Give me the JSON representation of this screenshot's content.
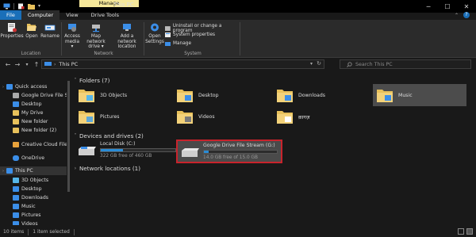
{
  "titlebar": {
    "title": "This PC",
    "context_tab": "Manage",
    "controls": [
      "─",
      "☐",
      "✕"
    ]
  },
  "tabs": [
    "File",
    "Computer",
    "View",
    "Drive Tools"
  ],
  "ribbon": {
    "location_group": {
      "label": "Location",
      "buttons": [
        "Properties",
        "Open",
        "Rename"
      ]
    },
    "network_group": {
      "label": "Network",
      "buttons": [
        "Access\nmedia ▾",
        "Map network\ndrive ▾",
        "Add a network\nlocation"
      ]
    },
    "system_group": {
      "label": "System",
      "open_settings": "Open\nSettings",
      "items": [
        "Uninstall or change a program",
        "System properties",
        "Manage"
      ]
    }
  },
  "address": {
    "path": "This PC",
    "search_placeholder": "Search This PC"
  },
  "navpane": {
    "items": [
      {
        "label": "Quick access",
        "icon": "star-icon",
        "color": "#3b8ee8",
        "expand": true
      },
      {
        "label": "Google Drive File S",
        "icon": "drive-icon",
        "color": "#aaaaaa"
      },
      {
        "label": "Desktop",
        "icon": "desktop-icon",
        "color": "#3b8ee8"
      },
      {
        "label": "My Drive",
        "icon": "folder-icon",
        "color": "#e8c15b"
      },
      {
        "label": "New folder",
        "icon": "folder-icon",
        "color": "#e8c15b"
      },
      {
        "label": "New folder (2)",
        "icon": "folder-icon",
        "color": "#e8c15b"
      },
      {
        "label": "Creative Cloud Files",
        "icon": "folder-icon",
        "color": "#e8a23b"
      },
      {
        "label": "OneDrive",
        "icon": "cloud-icon",
        "color": "#3b8ee8"
      },
      {
        "label": "This PC",
        "icon": "pc-icon",
        "color": "#3b8ee8",
        "selected": true,
        "expand": true
      },
      {
        "label": "3D Objects",
        "icon": "cube-icon",
        "color": "#56b6e8"
      },
      {
        "label": "Desktop",
        "icon": "desktop-icon",
        "color": "#3b8ee8"
      },
      {
        "label": "Downloads",
        "icon": "download-icon",
        "color": "#3b8ee8"
      },
      {
        "label": "Music",
        "icon": "music-icon",
        "color": "#3b8ee8"
      },
      {
        "label": "Pictures",
        "icon": "pictures-icon",
        "color": "#3b8ee8"
      },
      {
        "label": "Videos",
        "icon": "video-icon",
        "color": "#3b8ee8"
      }
    ]
  },
  "folders": {
    "heading": "Folders (7)",
    "items": [
      {
        "label": "3D Objects",
        "icon": "cube-icon"
      },
      {
        "label": "Desktop",
        "icon": "desktop-icon"
      },
      {
        "label": "Downloads",
        "icon": "download-icon"
      },
      {
        "label": "Music",
        "icon": "music-icon",
        "selected": true
      },
      {
        "label": "Pictures",
        "icon": "pictures-icon"
      },
      {
        "label": "Videos",
        "icon": "video-icon"
      },
      {
        "label": "क़ागज़",
        "icon": "document-icon"
      }
    ]
  },
  "drives": {
    "heading": "Devices and drives (2)",
    "items": [
      {
        "label": "Local Disk (C:)",
        "free": "322 GB free of 460 GB",
        "used_fraction": 0.3
      },
      {
        "label": "Google Drive File Stream (G:)",
        "free": "14.0 GB free of 15.0 GB",
        "used_fraction": 0.07
      }
    ]
  },
  "network": {
    "heading": "Network locations (1)"
  },
  "status": {
    "items": "10 items",
    "selected": "1 item selected"
  },
  "colors": {
    "accent": "#1a6fb9",
    "folder": "#e8c15b",
    "highlight_border": "#c8232c"
  }
}
